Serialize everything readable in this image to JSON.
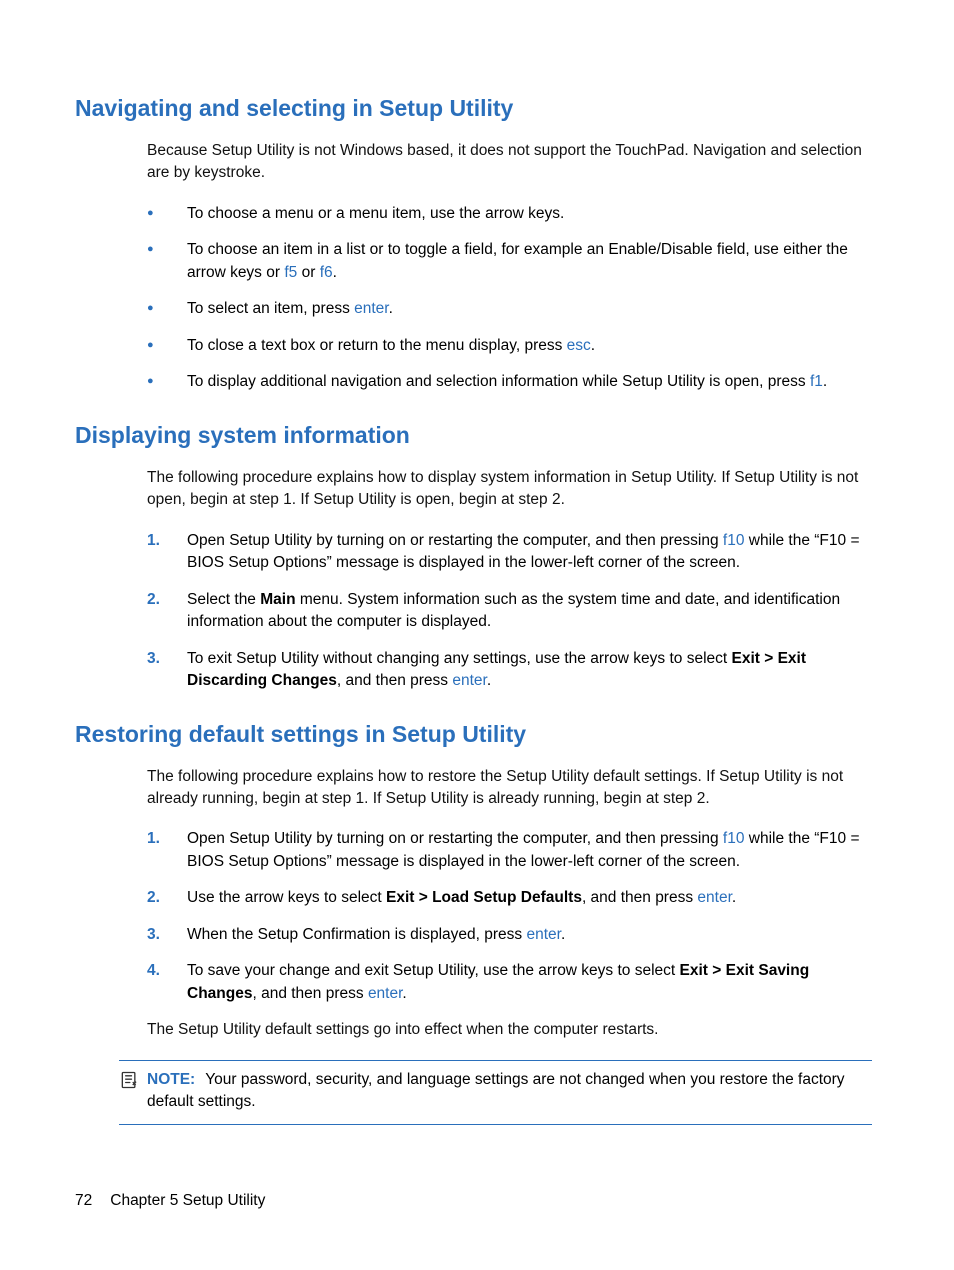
{
  "sections": {
    "nav": {
      "heading": "Navigating and selecting in Setup Utility",
      "intro": "Because Setup Utility is not Windows based, it does not support the TouchPad. Navigation and selection are by keystroke.",
      "b1": "To choose a menu or a menu item, use the arrow keys.",
      "b2a": "To choose an item in a list or to toggle a field, for example an Enable/Disable field, use either the arrow keys or ",
      "b2_f5": "f5",
      "b2_or": " or ",
      "b2_f6": "f6",
      "b2_end": ".",
      "b3a": "To select an item, press ",
      "b3_enter": "enter",
      "b3_end": ".",
      "b4a": "To close a text box or return to the menu display, press ",
      "b4_esc": "esc",
      "b4_end": ".",
      "b5a": "To display additional navigation and selection information while Setup Utility is open, press ",
      "b5_f1": "f1",
      "b5_end": "."
    },
    "sysinfo": {
      "heading": "Displaying system information",
      "intro": "The following procedure explains how to display system information in Setup Utility. If Setup Utility is not open, begin at step 1. If Setup Utility is open, begin at step 2.",
      "s1a": "Open Setup Utility by turning on or restarting the computer, and then pressing ",
      "s1_f10": "f10",
      "s1b": " while the “F10 = BIOS Setup Options” message is displayed in the lower-left corner of the screen.",
      "s2a": "Select the ",
      "s2_main": "Main",
      "s2b": " menu. System information such as the system time and date, and identification information about the computer is displayed.",
      "s3a": "To exit Setup Utility without changing any settings, use the arrow keys to select ",
      "s3_exit": "Exit > Exit Discarding Changes",
      "s3b": ", and then press ",
      "s3_enter": "enter",
      "s3_end": "."
    },
    "restore": {
      "heading": "Restoring default settings in Setup Utility",
      "intro": "The following procedure explains how to restore the Setup Utility default settings. If Setup Utility is not already running, begin at step 1. If Setup Utility is already running, begin at step 2.",
      "s1a": "Open Setup Utility by turning on or restarting the computer, and then pressing ",
      "s1_f10": "f10",
      "s1b": " while the “F10 = BIOS Setup Options” message is displayed in the lower-left corner of the screen.",
      "s2a": "Use the arrow keys to select ",
      "s2_exit": "Exit > Load Setup Defaults",
      "s2b": ", and then press ",
      "s2_enter": "enter",
      "s2_end": ".",
      "s3a": "When the Setup Confirmation is displayed, press ",
      "s3_enter": "enter",
      "s3_end": ".",
      "s4a": "To save your change and exit Setup Utility, use the arrow keys to select ",
      "s4_exit": "Exit > Exit Saving Changes",
      "s4b": ", and then press ",
      "s4_enter": "enter",
      "s4_end": ".",
      "outro": "The Setup Utility default settings go into effect when the computer restarts.",
      "note_label": "NOTE:",
      "note_text": "Your password, security, and language settings are not changed when you restore the factory default settings."
    }
  },
  "footer": {
    "page": "72",
    "chapter": "Chapter 5   Setup Utility"
  }
}
